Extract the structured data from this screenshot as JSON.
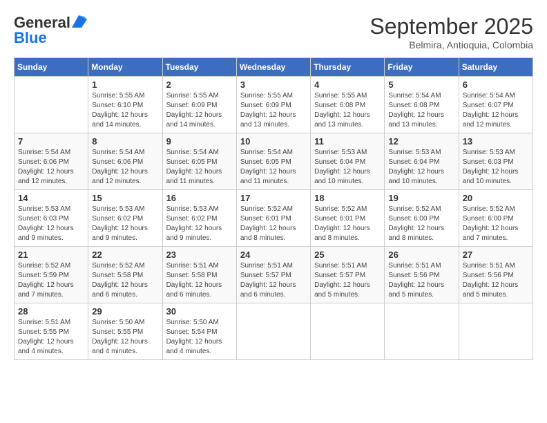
{
  "header": {
    "logo_general": "General",
    "logo_blue": "Blue",
    "month_title": "September 2025",
    "location": "Belmira, Antioquia, Colombia"
  },
  "weekdays": [
    "Sunday",
    "Monday",
    "Tuesday",
    "Wednesday",
    "Thursday",
    "Friday",
    "Saturday"
  ],
  "weeks": [
    [
      {
        "day": "",
        "info": ""
      },
      {
        "day": "1",
        "info": "Sunrise: 5:55 AM\nSunset: 6:10 PM\nDaylight: 12 hours\nand 14 minutes."
      },
      {
        "day": "2",
        "info": "Sunrise: 5:55 AM\nSunset: 6:09 PM\nDaylight: 12 hours\nand 14 minutes."
      },
      {
        "day": "3",
        "info": "Sunrise: 5:55 AM\nSunset: 6:09 PM\nDaylight: 12 hours\nand 13 minutes."
      },
      {
        "day": "4",
        "info": "Sunrise: 5:55 AM\nSunset: 6:08 PM\nDaylight: 12 hours\nand 13 minutes."
      },
      {
        "day": "5",
        "info": "Sunrise: 5:54 AM\nSunset: 6:08 PM\nDaylight: 12 hours\nand 13 minutes."
      },
      {
        "day": "6",
        "info": "Sunrise: 5:54 AM\nSunset: 6:07 PM\nDaylight: 12 hours\nand 12 minutes."
      }
    ],
    [
      {
        "day": "7",
        "info": "Sunrise: 5:54 AM\nSunset: 6:06 PM\nDaylight: 12 hours\nand 12 minutes."
      },
      {
        "day": "8",
        "info": "Sunrise: 5:54 AM\nSunset: 6:06 PM\nDaylight: 12 hours\nand 12 minutes."
      },
      {
        "day": "9",
        "info": "Sunrise: 5:54 AM\nSunset: 6:05 PM\nDaylight: 12 hours\nand 11 minutes."
      },
      {
        "day": "10",
        "info": "Sunrise: 5:54 AM\nSunset: 6:05 PM\nDaylight: 12 hours\nand 11 minutes."
      },
      {
        "day": "11",
        "info": "Sunrise: 5:53 AM\nSunset: 6:04 PM\nDaylight: 12 hours\nand 10 minutes."
      },
      {
        "day": "12",
        "info": "Sunrise: 5:53 AM\nSunset: 6:04 PM\nDaylight: 12 hours\nand 10 minutes."
      },
      {
        "day": "13",
        "info": "Sunrise: 5:53 AM\nSunset: 6:03 PM\nDaylight: 12 hours\nand 10 minutes."
      }
    ],
    [
      {
        "day": "14",
        "info": "Sunrise: 5:53 AM\nSunset: 6:03 PM\nDaylight: 12 hours\nand 9 minutes."
      },
      {
        "day": "15",
        "info": "Sunrise: 5:53 AM\nSunset: 6:02 PM\nDaylight: 12 hours\nand 9 minutes."
      },
      {
        "day": "16",
        "info": "Sunrise: 5:53 AM\nSunset: 6:02 PM\nDaylight: 12 hours\nand 9 minutes."
      },
      {
        "day": "17",
        "info": "Sunrise: 5:52 AM\nSunset: 6:01 PM\nDaylight: 12 hours\nand 8 minutes."
      },
      {
        "day": "18",
        "info": "Sunrise: 5:52 AM\nSunset: 6:01 PM\nDaylight: 12 hours\nand 8 minutes."
      },
      {
        "day": "19",
        "info": "Sunrise: 5:52 AM\nSunset: 6:00 PM\nDaylight: 12 hours\nand 8 minutes."
      },
      {
        "day": "20",
        "info": "Sunrise: 5:52 AM\nSunset: 6:00 PM\nDaylight: 12 hours\nand 7 minutes."
      }
    ],
    [
      {
        "day": "21",
        "info": "Sunrise: 5:52 AM\nSunset: 5:59 PM\nDaylight: 12 hours\nand 7 minutes."
      },
      {
        "day": "22",
        "info": "Sunrise: 5:52 AM\nSunset: 5:58 PM\nDaylight: 12 hours\nand 6 minutes."
      },
      {
        "day": "23",
        "info": "Sunrise: 5:51 AM\nSunset: 5:58 PM\nDaylight: 12 hours\nand 6 minutes."
      },
      {
        "day": "24",
        "info": "Sunrise: 5:51 AM\nSunset: 5:57 PM\nDaylight: 12 hours\nand 6 minutes."
      },
      {
        "day": "25",
        "info": "Sunrise: 5:51 AM\nSunset: 5:57 PM\nDaylight: 12 hours\nand 5 minutes."
      },
      {
        "day": "26",
        "info": "Sunrise: 5:51 AM\nSunset: 5:56 PM\nDaylight: 12 hours\nand 5 minutes."
      },
      {
        "day": "27",
        "info": "Sunrise: 5:51 AM\nSunset: 5:56 PM\nDaylight: 12 hours\nand 5 minutes."
      }
    ],
    [
      {
        "day": "28",
        "info": "Sunrise: 5:51 AM\nSunset: 5:55 PM\nDaylight: 12 hours\nand 4 minutes."
      },
      {
        "day": "29",
        "info": "Sunrise: 5:50 AM\nSunset: 5:55 PM\nDaylight: 12 hours\nand 4 minutes."
      },
      {
        "day": "30",
        "info": "Sunrise: 5:50 AM\nSunset: 5:54 PM\nDaylight: 12 hours\nand 4 minutes."
      },
      {
        "day": "",
        "info": ""
      },
      {
        "day": "",
        "info": ""
      },
      {
        "day": "",
        "info": ""
      },
      {
        "day": "",
        "info": ""
      }
    ]
  ]
}
